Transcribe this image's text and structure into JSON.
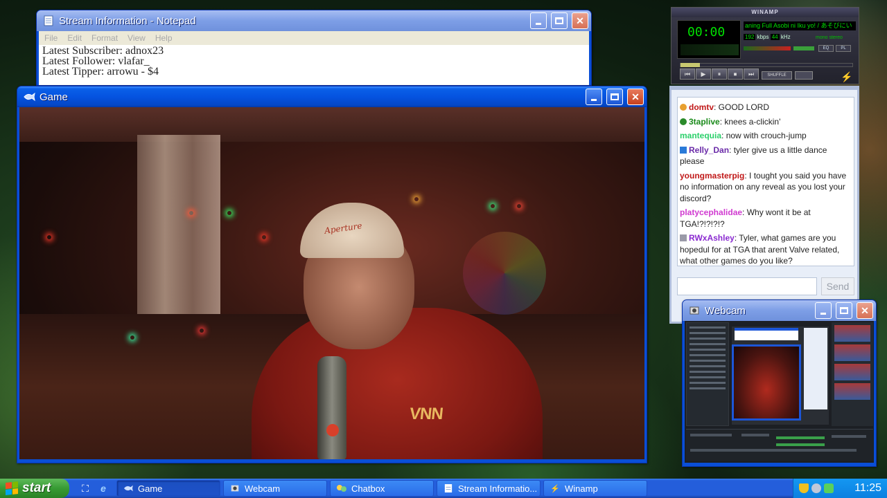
{
  "notepad": {
    "title": "Stream Information - Notepad",
    "menu": [
      "File",
      "Edit",
      "Format",
      "View",
      "Help"
    ],
    "lines": [
      "Latest Subscriber: adnox23",
      "Latest Follower: vlafar_",
      "Latest Tipper: arrowu - $4"
    ]
  },
  "game": {
    "title": "Game",
    "cap_text": "Aperture",
    "shirt_text": "VNN"
  },
  "winamp": {
    "title": "WINAMP",
    "time": "00:00",
    "ticker": "aning Full Asobi ni Iku yo! / あそびにい",
    "kbps": "192",
    "kbps_label": "kbps",
    "khz": "44",
    "khz_label": "kHz",
    "stereo": "mono  stereo",
    "eq_label": "EQ",
    "pl_label": "PL",
    "shuffle_label": "SHUFFLE",
    "controls": [
      "⏮",
      "▶",
      "⏸",
      "⏹",
      "⏭",
      "⏏"
    ]
  },
  "chat": {
    "messages": [
      {
        "user": "domtv",
        "color": "#c01818",
        "text": "GOOD LORD",
        "badge": "orange"
      },
      {
        "user": "3taplive",
        "color": "#1a8a1a",
        "text": "knees a-clickin'",
        "badge": "green"
      },
      {
        "user": "mantequia",
        "color": "#2ad06a",
        "text": "now with crouch-jump",
        "badge": ""
      },
      {
        "user": "Relly_Dan",
        "color": "#6a2aa8",
        "text": "tyler give us a little dance please",
        "badge": "blue"
      },
      {
        "user": "youngmasterpig",
        "color": "#c01818",
        "text": "I tought you said you have no information on any reveal as you lost your discord?",
        "badge": ""
      },
      {
        "user": "platycephalidae",
        "color": "#d03ad0",
        "text": "Why wont it be at TGA!?!?!?!?",
        "badge": ""
      },
      {
        "user": "RWxAshley",
        "color": "#8a2ad0",
        "text": "Tyler, what games are you hopedul for at TGA that arent Valve related, what other games do you like?",
        "badge": "gray"
      }
    ],
    "send_label": "Send",
    "input_value": ""
  },
  "webcam": {
    "title": "Webcam"
  },
  "taskbar": {
    "start_label": "start",
    "tasks": [
      {
        "label": "Game",
        "active": true
      },
      {
        "label": "Webcam",
        "active": false
      },
      {
        "label": "Chatbox",
        "active": false
      },
      {
        "label": "Stream Informatio...",
        "active": false
      },
      {
        "label": "Winamp",
        "active": false
      }
    ],
    "clock": "11:25"
  },
  "colors": {
    "xp_title_blue": "#0553e0",
    "start_green": "#379b34",
    "taskbar_blue": "#245edb",
    "close_red": "#c5401e"
  }
}
